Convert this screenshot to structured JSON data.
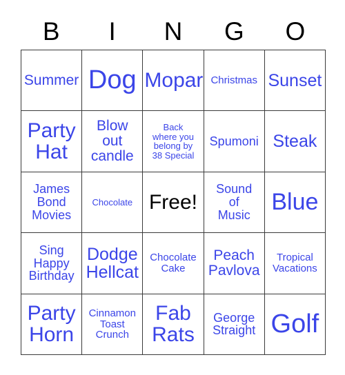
{
  "card": {
    "header": {
      "letters": [
        "B",
        "I",
        "N",
        "G",
        "O"
      ]
    },
    "colors": {
      "text_blue": "#3b45e8",
      "free_black": "#000000",
      "grid_line": "#3a3a3a",
      "background": "#ffffff"
    },
    "rows": [
      [
        {
          "text": "Summer",
          "size": "s-sm",
          "free": false
        },
        {
          "text": "Dog",
          "size": "s-xxl",
          "free": false
        },
        {
          "text": "Mopar",
          "size": "s-lg",
          "free": false
        },
        {
          "text": "Christmas",
          "size": "s-xxs",
          "free": false
        },
        {
          "text": "Sunset",
          "size": "s-md",
          "free": false
        }
      ],
      [
        {
          "text": "Party\nHat",
          "size": "s-lg",
          "free": false
        },
        {
          "text": "Blow\nout\ncandle",
          "size": "s-sm",
          "free": false
        },
        {
          "text": "Back\nwhere you\nbelong by\n38 Special",
          "size": "s-tiny",
          "free": false
        },
        {
          "text": "Spumoni",
          "size": "s-xs",
          "free": false
        },
        {
          "text": "Steak",
          "size": "s-md",
          "free": false
        }
      ],
      [
        {
          "text": "James\nBond\nMovies",
          "size": "s-xs",
          "free": false
        },
        {
          "text": "Chocolate",
          "size": "s-tiny",
          "free": false
        },
        {
          "text": "Free!",
          "size": "s-lg",
          "free": true
        },
        {
          "text": "Sound\nof\nMusic",
          "size": "s-xs",
          "free": false
        },
        {
          "text": "Blue",
          "size": "s-xl",
          "free": false
        }
      ],
      [
        {
          "text": "Sing\nHappy\nBirthday",
          "size": "s-xs",
          "free": false
        },
        {
          "text": "Dodge\nHellcat",
          "size": "s-md",
          "free": false
        },
        {
          "text": "Chocolate\nCake",
          "size": "s-xxs",
          "free": false
        },
        {
          "text": "Peach\nPavlova",
          "size": "s-sm",
          "free": false
        },
        {
          "text": "Tropical\nVacations",
          "size": "s-xxs",
          "free": false
        }
      ],
      [
        {
          "text": "Party\nHorn",
          "size": "s-lg",
          "free": false
        },
        {
          "text": "Cinnamon\nToast\nCrunch",
          "size": "s-xxs",
          "free": false
        },
        {
          "text": "Fab\nRats",
          "size": "s-lg",
          "free": false
        },
        {
          "text": "George\nStraight",
          "size": "s-xs",
          "free": false
        },
        {
          "text": "Golf",
          "size": "s-xxl",
          "free": false
        }
      ]
    ]
  }
}
